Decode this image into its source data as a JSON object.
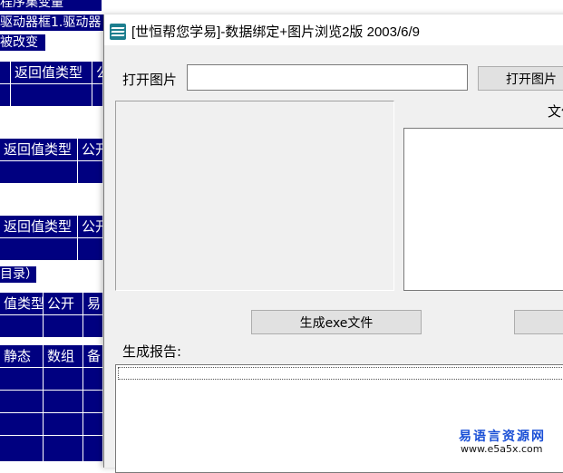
{
  "background_ide": {
    "top_line1": "程序集变量",
    "top_line2": "驱动器框1.驱动器",
    "sub_line": "被改变（）",
    "header_row_a": [
      "",
      "返回值类型",
      "公"
    ],
    "header_row_b": [
      "",
      "返回值类型",
      "公开"
    ],
    "header_row_c": [
      "",
      "返回值类型",
      "公开"
    ],
    "section_label": "目录）",
    "header_row_d": [
      "值类型",
      "公开",
      "易"
    ],
    "var_header": [
      "",
      "静态",
      "数组",
      "备"
    ]
  },
  "window": {
    "title": "[世恒帮您学易]-数据绑定+图片浏览2版 2003/6/9"
  },
  "open_image_label": "打开图片",
  "open_image_input_value": "",
  "open_image_button_label": "打开图片",
  "file_label": "文件",
  "generate_exe_button_label": "生成exe文件",
  "report_label": "生成报告:",
  "report_value": "",
  "watermark": {
    "cn": "易语言资源网",
    "url": "www.e5a5x.com"
  }
}
